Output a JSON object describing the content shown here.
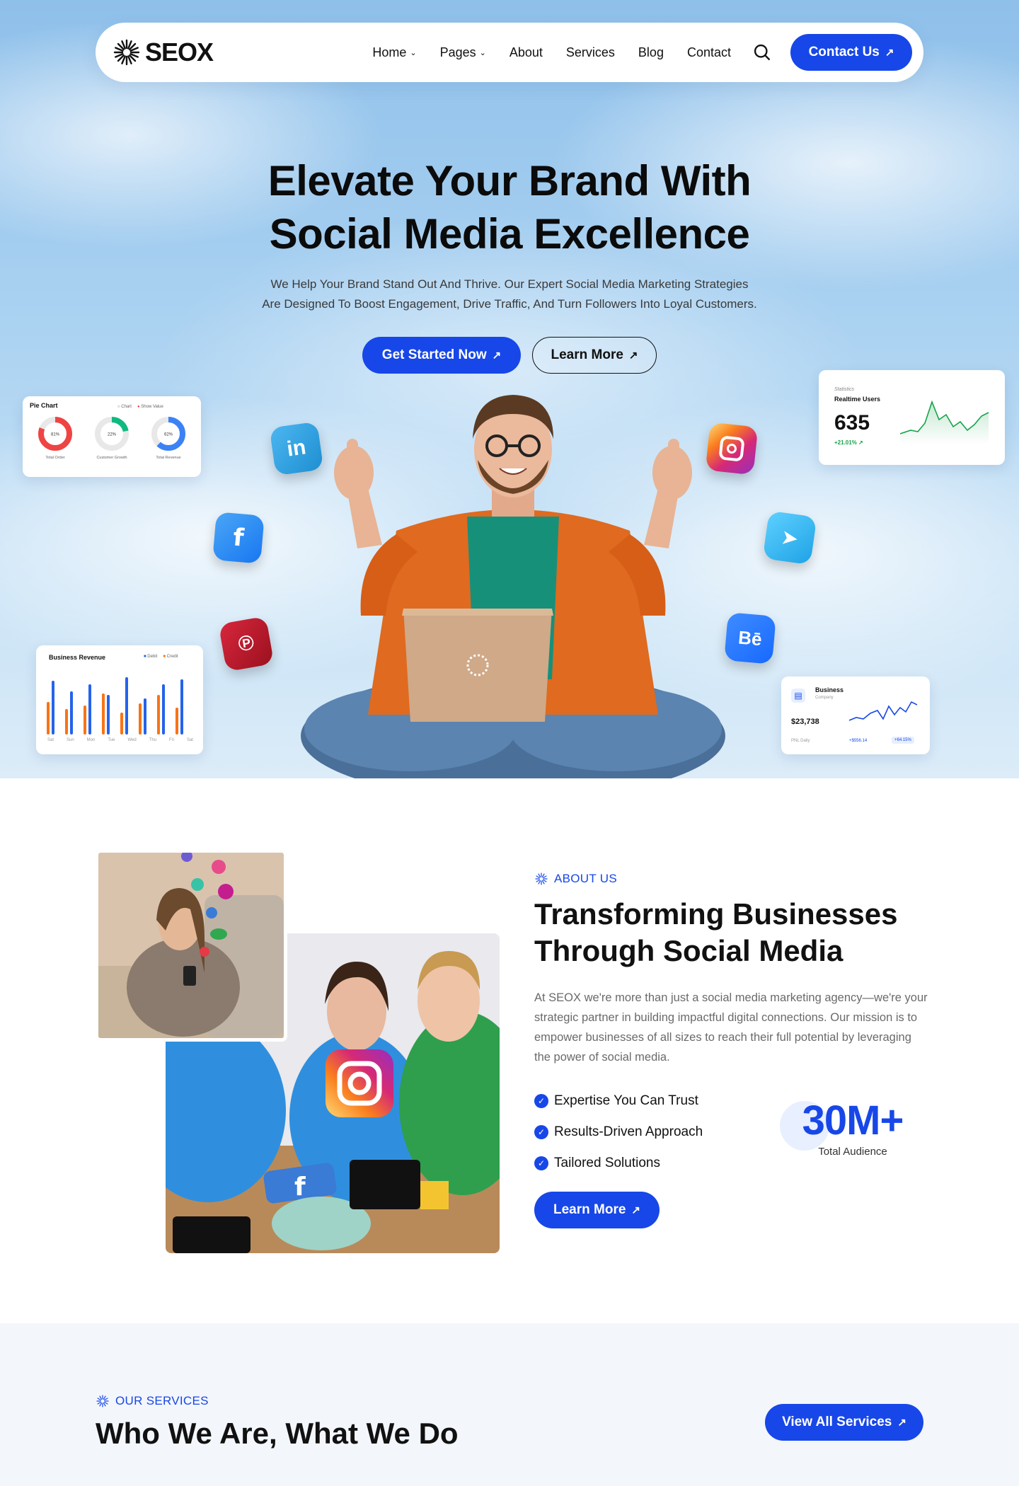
{
  "brand": {
    "name": "SEOX",
    "accent": "#1747e8"
  },
  "nav": {
    "items": [
      {
        "label": "Home",
        "has_dropdown": true
      },
      {
        "label": "Pages",
        "has_dropdown": true
      },
      {
        "label": "About",
        "has_dropdown": false
      },
      {
        "label": "Services",
        "has_dropdown": false
      },
      {
        "label": "Blog",
        "has_dropdown": false
      },
      {
        "label": "Contact",
        "has_dropdown": false
      }
    ],
    "search_icon": "search-icon",
    "cta": "Contact Us"
  },
  "hero": {
    "title_line1": "Elevate Your Brand With",
    "title_line2": "Social Media Excellence",
    "subtitle_line1": "We Help Your Brand Stand Out And Thrive. Our Expert Social Media Marketing Strategies",
    "subtitle_line2": "Are Designed To Boost Engagement, Drive Traffic, And Turn Followers Into Loyal Customers.",
    "primary_button": "Get Started Now",
    "secondary_button": "Learn More"
  },
  "widgets": {
    "pie_chart": {
      "title": "Pie Chart",
      "legend": [
        "Chart",
        "Show Value"
      ],
      "items": [
        {
          "label": "Total Order",
          "value": "81%",
          "pct": 0.81,
          "color": "#ef4444"
        },
        {
          "label": "Customer Growth",
          "value": "22%",
          "pct": 0.22,
          "color": "#10b981"
        },
        {
          "label": "Total Revenue",
          "value": "62%",
          "pct": 0.62,
          "color": "#3b82f6"
        }
      ]
    },
    "realtime": {
      "label": "Statistics",
      "title": "Realtime Users",
      "value": "635",
      "change": "+21.01%"
    },
    "revenue": {
      "title": "Business Revenue",
      "legend": [
        "Debit",
        "Credit"
      ],
      "days": [
        "Sat",
        "Sun",
        "Mon",
        "Tue",
        "Wed",
        "Thu",
        "Fri",
        "Sat"
      ]
    },
    "business": {
      "title": "Business",
      "subtitle": "Company",
      "value": "$23,738",
      "label": "PNL Daily",
      "change": "+$556.14",
      "percent": "+64.15%"
    }
  },
  "social_icons": [
    "linkedin-icon",
    "facebook-icon",
    "pinterest-icon",
    "instagram-icon",
    "telegram-icon",
    "behance-icon"
  ],
  "about": {
    "eyebrow": "ABOUT US",
    "title_line1": "Transforming Businesses",
    "title_line2": "Through Social Media",
    "description": "At SEOX we're more than just a social media marketing agency—we're your strategic partner in building impactful digital connections. Our mission is to empower businesses of all sizes to reach their full potential by leveraging the power of social media.",
    "features": [
      "Expertise You Can Trust",
      "Results-Driven Approach",
      "Tailored Solutions"
    ],
    "stat_value": "30M+",
    "stat_label": "Total Audience",
    "button": "Learn More"
  },
  "services": {
    "eyebrow": "OUR SERVICES",
    "title": "Who We Are, What We Do",
    "button": "View All Services"
  }
}
